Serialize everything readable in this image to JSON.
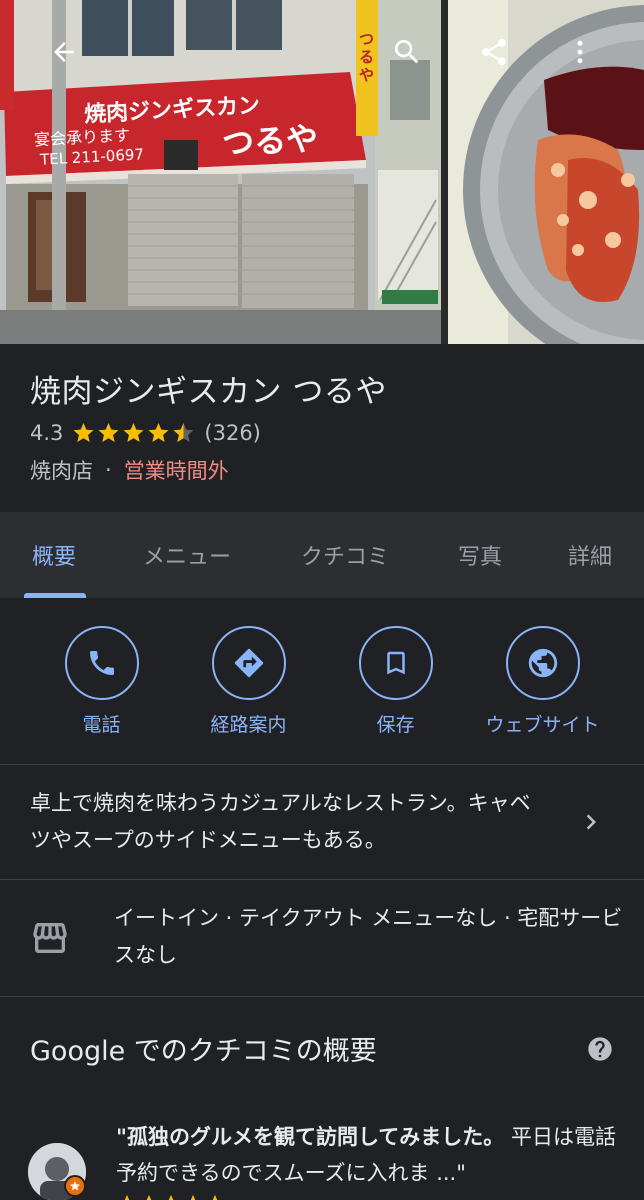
{
  "header": {
    "back_icon": "arrow-back-icon",
    "search_icon": "search-icon",
    "share_icon": "share-icon",
    "more_icon": "more-vert-icon",
    "sign": {
      "name": "焼肉ジンギスカン",
      "brand": "つるや",
      "sub": "宴会承ります",
      "tel": "TEL 211-0697",
      "vertical": "つるや"
    }
  },
  "place": {
    "title": "焼肉ジンギスカン つるや",
    "rating": "4.3",
    "stars_value": 4.3,
    "review_count": "(326)",
    "category": "焼肉店",
    "separator": "·",
    "status": "営業時間外"
  },
  "tabs": [
    {
      "label": "概要",
      "active": true
    },
    {
      "label": "メニュー",
      "active": false
    },
    {
      "label": "クチコミ",
      "active": false
    },
    {
      "label": "写真",
      "active": false
    },
    {
      "label": "詳細",
      "active": false
    }
  ],
  "actions": [
    {
      "label": "電話",
      "icon": "phone-icon"
    },
    {
      "label": "経路案内",
      "icon": "directions-icon"
    },
    {
      "label": "保存",
      "icon": "bookmark-icon"
    },
    {
      "label": "ウェブサイト",
      "icon": "globe-icon"
    }
  ],
  "description": {
    "text": "卓上で焼肉を味わうカジュアルなレストラン。キャベツやスープのサイドメニューもある。"
  },
  "service": {
    "icon": "storefront-icon",
    "text": "イートイン · テイクアウト メニューなし · 宅配サービスなし"
  },
  "reviews_summary": {
    "heading": "Google でのクチコミの概要",
    "help_icon": "help-icon",
    "review_bold": "\"孤独のグルメを観て訪問してみました。",
    "review_rest": " 平日は電話予約できるのでスムーズに入れま ...\""
  },
  "colors": {
    "background": "#202124",
    "accent": "#8ab4f8",
    "closed": "#f28b82",
    "star": "#fbbc04"
  }
}
